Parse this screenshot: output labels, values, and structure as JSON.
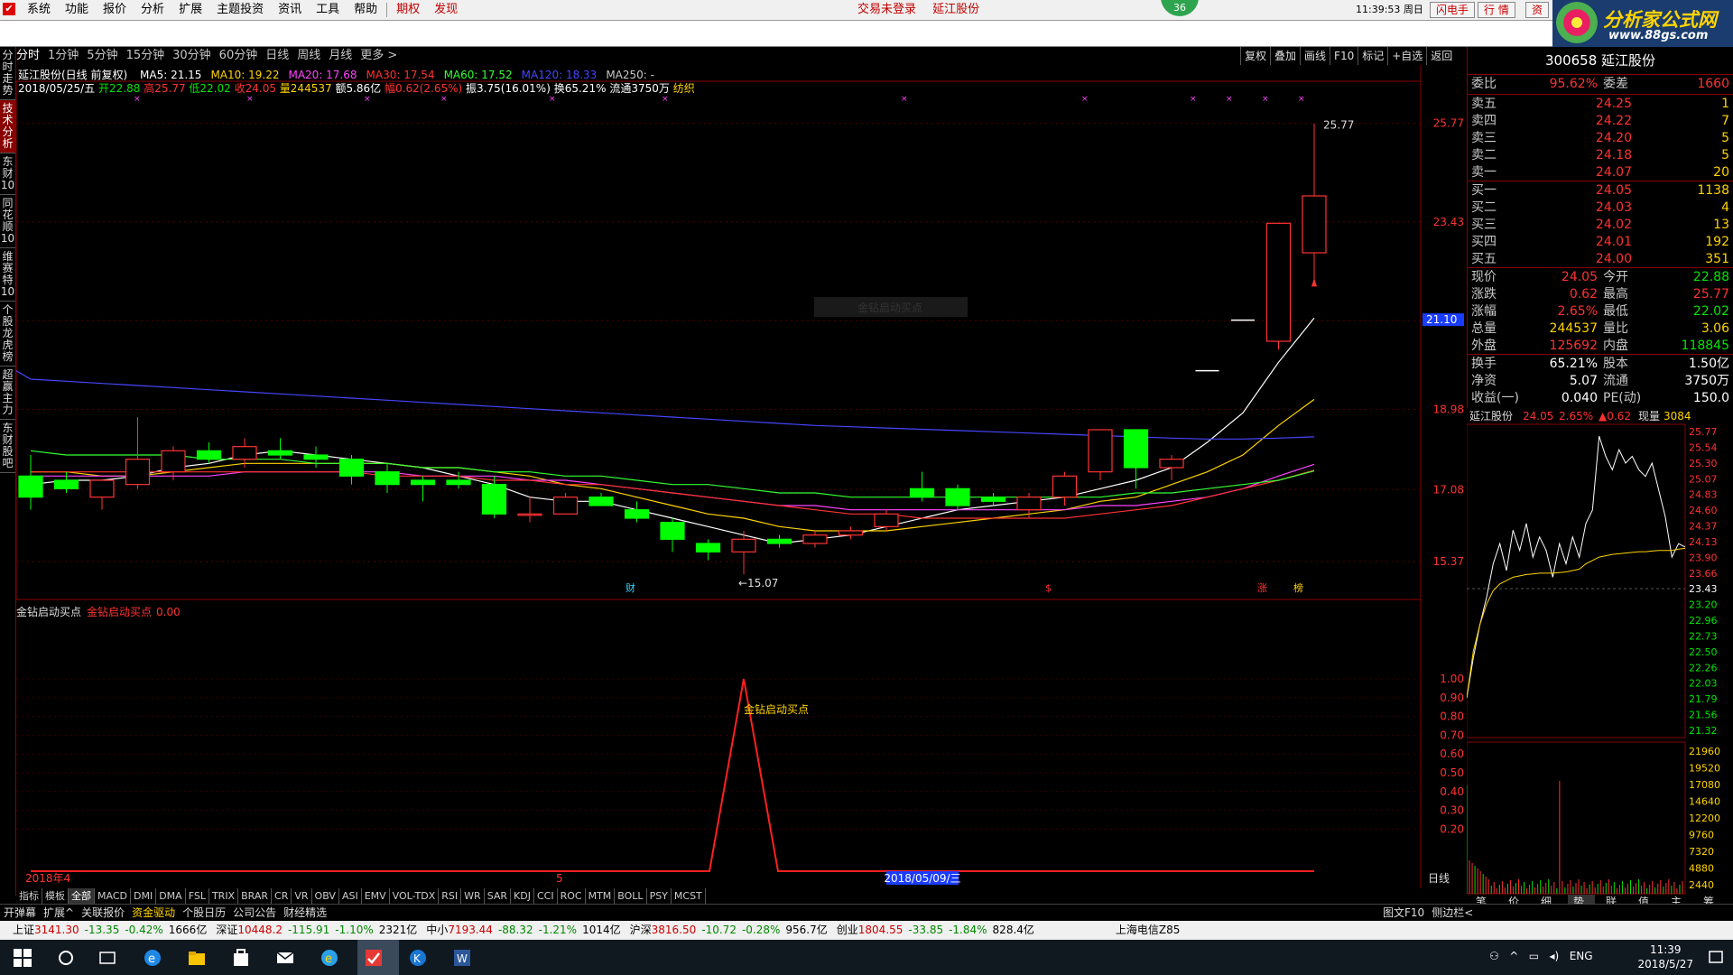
{
  "menu": {
    "items": [
      "系统",
      "功能",
      "报价",
      "分析",
      "扩展",
      "主题投资",
      "资讯",
      "工具",
      "帮助"
    ],
    "red_items": [
      "期权",
      "发现"
    ],
    "center_links": [
      "交易未登录",
      "延江股份"
    ],
    "badge": "36",
    "time_text": "11:39:53",
    "week_text": "周日",
    "flash_btn": "闪电手",
    "quote_btn": "行  情",
    "asset_btn": "资"
  },
  "logo": {
    "title": "分析家公式网",
    "url_text": "www.88gs.com"
  },
  "period": {
    "items": [
      "分时",
      "1分钟",
      "5分钟",
      "15分钟",
      "30分钟",
      "60分钟",
      "日线",
      "周线",
      "月线",
      "更多 >"
    ],
    "active_index": 0
  },
  "chart_toolbar": [
    "复权",
    "叠加",
    "画线",
    "F10",
    "标记",
    "+自选",
    "返回"
  ],
  "left_tabs": [
    "分时走势",
    "技术分析",
    "东财10",
    "同花顺10",
    "维赛特10",
    "个股龙虎榜",
    "超赢主力",
    "东财股吧"
  ],
  "left_tabs_active": 1,
  "info": {
    "stock": "延江股份(日线 前复权)",
    "ma": [
      {
        "label": "MA5: 21.15",
        "color": "#ffffff"
      },
      {
        "label": "MA10: 19.22",
        "color": "#ffd400"
      },
      {
        "label": "MA20: 17.68",
        "color": "#ff44ff"
      },
      {
        "label": "MA30: 17.54",
        "color": "#ff3232"
      },
      {
        "label": "MA60: 17.52",
        "color": "#33ff33"
      },
      {
        "label": "MA120: 18.33",
        "color": "#4646ff"
      },
      {
        "label": "MA250: -",
        "color": "#c8c8c8"
      }
    ],
    "date": "2018/05/25/五",
    "open": "开22.88",
    "high": "高25.77",
    "low": "低22.02",
    "close": "收24.05",
    "vol": "量244537",
    "amt": "额5.86亿",
    "pct": "幅0.62(2.65%)",
    "range": "振3.75(16.01%)",
    "turnover": "换65.21%",
    "float": "流通3750万",
    "industry": "纺织"
  },
  "chart_data": {
    "type": "candlestick",
    "price_axis": {
      "ticks": [
        25.77,
        23.43,
        21.09,
        18.98,
        17.08,
        15.37
      ],
      "ylim": [
        14.6,
        26.3
      ]
    },
    "current_price_tag": "21.10",
    "high_label": "25.77",
    "low_label": "15.07",
    "x_label_start": "2018年4",
    "x_label_mid": "5",
    "x_label_cursor": "2018/05/09/三",
    "event_marks": [
      "财",
      "$",
      "涨",
      "榜"
    ],
    "watermark": "金钻启动买点",
    "candles": [
      {
        "o": 17.4,
        "h": 17.9,
        "l": 16.6,
        "c": 16.9
      },
      {
        "o": 17.3,
        "h": 17.5,
        "l": 17.0,
        "c": 17.1
      },
      {
        "o": 16.9,
        "h": 17.3,
        "l": 16.6,
        "c": 17.3
      },
      {
        "o": 17.2,
        "h": 18.8,
        "l": 17.1,
        "c": 17.8
      },
      {
        "o": 17.5,
        "h": 18.1,
        "l": 17.3,
        "c": 18.0
      },
      {
        "o": 18.0,
        "h": 18.2,
        "l": 17.7,
        "c": 17.8
      },
      {
        "o": 17.8,
        "h": 18.3,
        "l": 17.6,
        "c": 18.1
      },
      {
        "o": 18.0,
        "h": 18.3,
        "l": 17.8,
        "c": 17.9
      },
      {
        "o": 17.9,
        "h": 18.1,
        "l": 17.6,
        "c": 17.8
      },
      {
        "o": 17.8,
        "h": 17.9,
        "l": 17.2,
        "c": 17.4
      },
      {
        "o": 17.5,
        "h": 17.7,
        "l": 17.0,
        "c": 17.2
      },
      {
        "o": 17.3,
        "h": 17.4,
        "l": 16.8,
        "c": 17.2
      },
      {
        "o": 17.3,
        "h": 17.5,
        "l": 17.1,
        "c": 17.2
      },
      {
        "o": 17.2,
        "h": 17.4,
        "l": 16.4,
        "c": 16.5
      },
      {
        "o": 16.5,
        "h": 16.9,
        "l": 16.3,
        "c": 16.5
      },
      {
        "o": 16.5,
        "h": 17.0,
        "l": 16.5,
        "c": 16.9
      },
      {
        "o": 16.9,
        "h": 17.0,
        "l": 16.7,
        "c": 16.7
      },
      {
        "o": 16.6,
        "h": 16.8,
        "l": 16.3,
        "c": 16.4
      },
      {
        "o": 16.3,
        "h": 16.4,
        "l": 15.6,
        "c": 15.9
      },
      {
        "o": 15.8,
        "h": 15.9,
        "l": 15.4,
        "c": 15.6
      },
      {
        "o": 15.6,
        "h": 16.1,
        "l": 15.07,
        "c": 15.9
      },
      {
        "o": 15.9,
        "h": 16.0,
        "l": 15.7,
        "c": 15.8
      },
      {
        "o": 15.8,
        "h": 16.1,
        "l": 15.7,
        "c": 16.0
      },
      {
        "o": 16.0,
        "h": 16.2,
        "l": 15.9,
        "c": 16.1
      },
      {
        "o": 16.2,
        "h": 16.6,
        "l": 16.1,
        "c": 16.5
      },
      {
        "o": 17.1,
        "h": 17.5,
        "l": 16.8,
        "c": 16.9
      },
      {
        "o": 17.1,
        "h": 17.2,
        "l": 16.6,
        "c": 16.7
      },
      {
        "o": 16.9,
        "h": 17.0,
        "l": 16.7,
        "c": 16.8
      },
      {
        "o": 16.6,
        "h": 17.0,
        "l": 16.4,
        "c": 16.9
      },
      {
        "o": 16.9,
        "h": 17.5,
        "l": 16.7,
        "c": 17.4
      },
      {
        "o": 17.5,
        "h": 18.5,
        "l": 17.3,
        "c": 18.5
      },
      {
        "o": 18.5,
        "h": 18.5,
        "l": 17.1,
        "c": 17.6
      },
      {
        "o": 17.6,
        "h": 17.9,
        "l": 17.3,
        "c": 17.8
      },
      {
        "o": 19.9,
        "h": 19.9,
        "l": 19.9,
        "c": 19.9
      },
      {
        "o": 21.1,
        "h": 21.1,
        "l": 21.1,
        "c": 21.1
      },
      {
        "o": 20.6,
        "h": 23.4,
        "l": 20.4,
        "c": 23.4
      },
      {
        "o": 22.7,
        "h": 25.77,
        "l": 22.0,
        "c": 24.05
      }
    ],
    "ma_lines": {
      "MA5": [
        17.2,
        17.3,
        17.3,
        17.4,
        17.6,
        17.7,
        17.9,
        18.0,
        17.9,
        17.8,
        17.7,
        17.6,
        17.4,
        17.2,
        16.9,
        16.8,
        16.8,
        16.6,
        16.4,
        16.2,
        16.0,
        15.8,
        15.9,
        16.0,
        16.2,
        16.4,
        16.6,
        16.7,
        16.8,
        16.9,
        17.1,
        17.3,
        17.6,
        18.2,
        18.9,
        20.1,
        21.15
      ],
      "MA10": [
        17.5,
        17.5,
        17.4,
        17.4,
        17.5,
        17.6,
        17.7,
        17.7,
        17.7,
        17.7,
        17.7,
        17.6,
        17.6,
        17.5,
        17.4,
        17.2,
        17.1,
        16.9,
        16.7,
        16.5,
        16.4,
        16.2,
        16.1,
        16.1,
        16.1,
        16.2,
        16.3,
        16.4,
        16.5,
        16.6,
        16.8,
        16.9,
        17.2,
        17.5,
        17.9,
        18.6,
        19.22
      ],
      "MA20": [
        17.4,
        17.4,
        17.4,
        17.4,
        17.4,
        17.4,
        17.5,
        17.5,
        17.5,
        17.5,
        17.5,
        17.4,
        17.4,
        17.4,
        17.3,
        17.3,
        17.2,
        17.1,
        17.0,
        16.9,
        16.8,
        16.7,
        16.7,
        16.6,
        16.6,
        16.6,
        16.6,
        16.6,
        16.6,
        16.6,
        16.7,
        16.7,
        16.8,
        16.9,
        17.1,
        17.4,
        17.68
      ],
      "MA30": [
        17.5,
        17.5,
        17.5,
        17.5,
        17.5,
        17.5,
        17.5,
        17.5,
        17.5,
        17.5,
        17.4,
        17.4,
        17.4,
        17.3,
        17.3,
        17.2,
        17.2,
        17.1,
        17.0,
        16.9,
        16.8,
        16.7,
        16.6,
        16.5,
        16.5,
        16.4,
        16.4,
        16.4,
        16.4,
        16.4,
        16.5,
        16.6,
        16.7,
        16.9,
        17.1,
        17.3,
        17.54
      ],
      "MA60": [
        18.0,
        17.9,
        17.9,
        17.9,
        17.9,
        17.8,
        17.8,
        17.8,
        17.7,
        17.7,
        17.7,
        17.6,
        17.6,
        17.5,
        17.5,
        17.4,
        17.4,
        17.3,
        17.2,
        17.2,
        17.1,
        17.0,
        17.0,
        16.9,
        16.9,
        16.9,
        16.9,
        16.9,
        16.9,
        16.9,
        16.9,
        17.0,
        17.0,
        17.1,
        17.2,
        17.3,
        17.52
      ],
      "MA120": [
        19.7,
        19.65,
        19.6,
        19.55,
        19.5,
        19.45,
        19.4,
        19.35,
        19.3,
        19.25,
        19.2,
        19.15,
        19.1,
        19.05,
        19.0,
        18.95,
        18.9,
        18.85,
        18.8,
        18.75,
        18.7,
        18.65,
        18.6,
        18.57,
        18.54,
        18.51,
        18.48,
        18.45,
        18.42,
        18.39,
        18.36,
        18.33,
        18.3,
        18.28,
        18.28,
        18.3,
        18.33
      ]
    },
    "indicator": {
      "title": "金钻启动买点",
      "legend": "金钻启动买点",
      "legend_value": "0.00",
      "signal_label": "金钻启动买点",
      "axis_ticks": [
        1.0,
        0.9,
        0.8,
        0.7,
        0.6,
        0.5,
        0.4,
        0.3,
        0.2
      ],
      "signal_index": 20
    }
  },
  "quote": {
    "code_name": "300658 延江股份",
    "weibi_label": "委比",
    "weibi": "95.62%",
    "weicha_label": "委差",
    "weicha": "1660",
    "sell": [
      {
        "label": "卖五",
        "price": "24.25",
        "vol": "1"
      },
      {
        "label": "卖四",
        "price": "24.22",
        "vol": "7"
      },
      {
        "label": "卖三",
        "price": "24.20",
        "vol": "5"
      },
      {
        "label": "卖二",
        "price": "24.18",
        "vol": "5"
      },
      {
        "label": "卖一",
        "price": "24.07",
        "vol": "20"
      }
    ],
    "buy": [
      {
        "label": "买一",
        "price": "24.05",
        "vol": "1138"
      },
      {
        "label": "买二",
        "price": "24.03",
        "vol": "4"
      },
      {
        "label": "买三",
        "price": "24.02",
        "vol": "13"
      },
      {
        "label": "买四",
        "price": "24.01",
        "vol": "192"
      },
      {
        "label": "买五",
        "price": "24.00",
        "vol": "351"
      }
    ],
    "stats": [
      {
        "l1": "现价",
        "v1": "24.05",
        "c1": "red",
        "l2": "今开",
        "v2": "22.88",
        "c2": "grn"
      },
      {
        "l1": "涨跌",
        "v1": "0.62",
        "c1": "red",
        "l2": "最高",
        "v2": "25.77",
        "c2": "red"
      },
      {
        "l1": "涨幅",
        "v1": "2.65%",
        "c1": "red",
        "l2": "最低",
        "v2": "22.02",
        "c2": "grn"
      },
      {
        "l1": "总量",
        "v1": "244537",
        "c1": "yel",
        "l2": "量比",
        "v2": "3.06",
        "c2": "yel"
      },
      {
        "l1": "外盘",
        "v1": "125692",
        "c1": "red",
        "l2": "内盘",
        "v2": "118845",
        "c2": "grn"
      }
    ],
    "stats2": [
      {
        "l1": "换手",
        "v1": "65.21%",
        "l2": "股本",
        "v2": "1.50亿"
      },
      {
        "l1": "净资",
        "v1": "5.07",
        "l2": "流通",
        "v2": "3750万"
      },
      {
        "l1": "收益(一)",
        "v1": "0.040",
        "l2": "PE(动)",
        "v2": "150.0"
      }
    ]
  },
  "mini": {
    "name": "延江股份",
    "price": "24.05",
    "pct": "2.65%",
    "chg": "▲0.62",
    "vol_label": "现量",
    "vol": "3084",
    "price_ticks": [
      "25.77",
      "25.54",
      "25.30",
      "25.07",
      "24.83",
      "24.60",
      "24.37",
      "24.13",
      "23.90",
      "23.66",
      "23.43",
      "23.20",
      "22.96",
      "22.73",
      "22.50",
      "22.26",
      "22.03",
      "21.79",
      "21.56",
      "21.32"
    ],
    "vol_ticks": [
      "21960",
      "19520",
      "17080",
      "14640",
      "12200",
      "9760",
      "7320",
      "4880",
      "2440"
    ],
    "tabs": [
      "笔",
      "价",
      "细",
      "势",
      "联",
      "值",
      "主",
      "筹"
    ],
    "tabs_active": 3
  },
  "indicator_tabs": [
    "指标",
    "模板",
    "全部",
    "MACD",
    "DMI",
    "DMA",
    "FSL",
    "TRIX",
    "BRAR",
    "CR",
    "VR",
    "OBV",
    "ASI",
    "EMV",
    "VOL-TDX",
    "RSI",
    "WR",
    "SAR",
    "KDJ",
    "CCI",
    "ROC",
    "MTM",
    "BOLL",
    "PSY",
    "MCST"
  ],
  "indicator_tabs_active": 2,
  "bottom_label": "日线",
  "func_bar": [
    "开弹幕",
    "扩展^",
    "关联报价",
    "资金驱动",
    "个股日历",
    "公司公告",
    "财经精选"
  ],
  "func_bar_right": [
    "图文F10",
    "侧边栏<"
  ],
  "status": {
    "sh": {
      "name": "上证",
      "val": "3141.30",
      "chg": "-13.35",
      "pct": "-0.42%",
      "amt": "1666亿"
    },
    "sz": {
      "name": "深证",
      "val": "10448.2",
      "chg": "-115.91",
      "pct": "-1.10%",
      "amt": "2321亿"
    },
    "zx": {
      "name": "中小",
      "val": "7193.44",
      "chg": "-88.32",
      "pct": "-1.21%",
      "amt": "1014亿"
    },
    "hs": {
      "name": "沪深",
      "val": "3816.50",
      "chg": "-10.72",
      "pct": "-0.28%",
      "amt": "956.7亿"
    },
    "cy": {
      "name": "创业",
      "val": "1804.55",
      "chg": "-33.85",
      "pct": "-1.84%",
      "amt": "828.4亿"
    },
    "server": "上海电信Z85"
  },
  "taskbar": {
    "time": "11:39",
    "date": "2018/5/27",
    "ime": "ENG"
  }
}
